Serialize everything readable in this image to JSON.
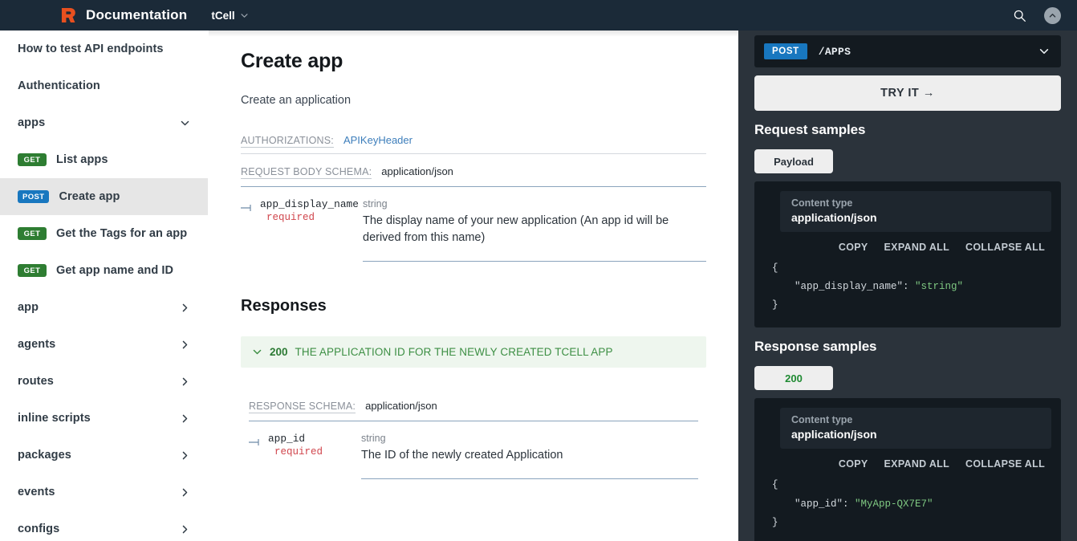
{
  "topbar": {
    "brand_title": "Documentation",
    "product": "tCell",
    "logo_icon": "rapid7-d-logo",
    "search_icon": "search-icon",
    "collapse_icon": "chevron-up-circle-icon",
    "background_color": "#1b2a38",
    "logo_color": "#e8501f"
  },
  "sidebar": {
    "items": [
      {
        "label": "How to test API endpoints",
        "type": "link"
      },
      {
        "label": "Authentication",
        "type": "link"
      },
      {
        "label": "apps",
        "type": "group",
        "expanded": true,
        "caret": "chevron-down-icon"
      },
      {
        "label": "List apps",
        "type": "endpoint",
        "method": "GET"
      },
      {
        "label": "Create app",
        "type": "endpoint",
        "method": "POST",
        "active": true
      },
      {
        "label": "Get the Tags for an app",
        "type": "endpoint",
        "method": "GET"
      },
      {
        "label": "Get app name and ID",
        "type": "endpoint",
        "method": "GET"
      },
      {
        "label": "app",
        "type": "group",
        "expanded": false,
        "caret": "chevron-right-icon"
      },
      {
        "label": "agents",
        "type": "group",
        "expanded": false,
        "caret": "chevron-right-icon"
      },
      {
        "label": "routes",
        "type": "group",
        "expanded": false,
        "caret": "chevron-right-icon"
      },
      {
        "label": "inline scripts",
        "type": "group",
        "expanded": false,
        "caret": "chevron-right-icon"
      },
      {
        "label": "packages",
        "type": "group",
        "expanded": false,
        "caret": "chevron-right-icon"
      },
      {
        "label": "events",
        "type": "group",
        "expanded": false,
        "caret": "chevron-right-icon"
      },
      {
        "label": "configs",
        "type": "group",
        "expanded": false,
        "caret": "chevron-right-icon"
      }
    ],
    "method_colors": {
      "GET": "#2e7d32",
      "POST": "#1877bf"
    }
  },
  "main": {
    "title": "Create app",
    "description": "Create an application",
    "authorizations_label": "AUTHORIZATIONS:",
    "authorizations_value": "APIKeyHeader",
    "request_body_label": "REQUEST BODY SCHEMA:",
    "request_body_value": "application/json",
    "request_param": {
      "name": "app_display_name",
      "required_label": "required",
      "type": "string",
      "description": "The display name of your new application (An app id will be derived from this name)"
    },
    "responses_title": "Responses",
    "response": {
      "code": "200",
      "text": "THE APPLICATION ID FOR THE NEWLY CREATED TCELL APP",
      "caret": "chevron-down-icon"
    },
    "response_schema_label": "RESPONSE SCHEMA:",
    "response_schema_value": "application/json",
    "response_param": {
      "name": "app_id",
      "required_label": "required",
      "type": "string",
      "description": "The ID of the newly created Application"
    }
  },
  "rightpanel": {
    "endpoint": {
      "method": "POST",
      "path": "/APPS",
      "caret": "chevron-down-icon"
    },
    "try_it_label": "TRY IT →",
    "request_samples": {
      "heading": "Request samples",
      "tab": "Payload",
      "content_type_label": "Content type",
      "content_type_value": "application/json",
      "actions": [
        "COPY",
        "EXPAND ALL",
        "COLLAPSE ALL"
      ],
      "code": {
        "open": "{",
        "key": "\"app_display_name\"",
        "sep": ": ",
        "value": "\"string\"",
        "close": "}"
      }
    },
    "response_samples": {
      "heading": "Response samples",
      "tab": "200",
      "content_type_label": "Content type",
      "content_type_value": "application/json",
      "actions": [
        "COPY",
        "EXPAND ALL",
        "COLLAPSE ALL"
      ],
      "code": {
        "open": "{",
        "key": "\"app_id\"",
        "sep": ": ",
        "value": "\"MyApp-QX7E7\"",
        "close": "}"
      }
    },
    "colors": {
      "panel_bg": "#2b333b",
      "code_bg": "#131a20",
      "string_green": "#7fc982",
      "status_green": "#1f8a32"
    }
  }
}
